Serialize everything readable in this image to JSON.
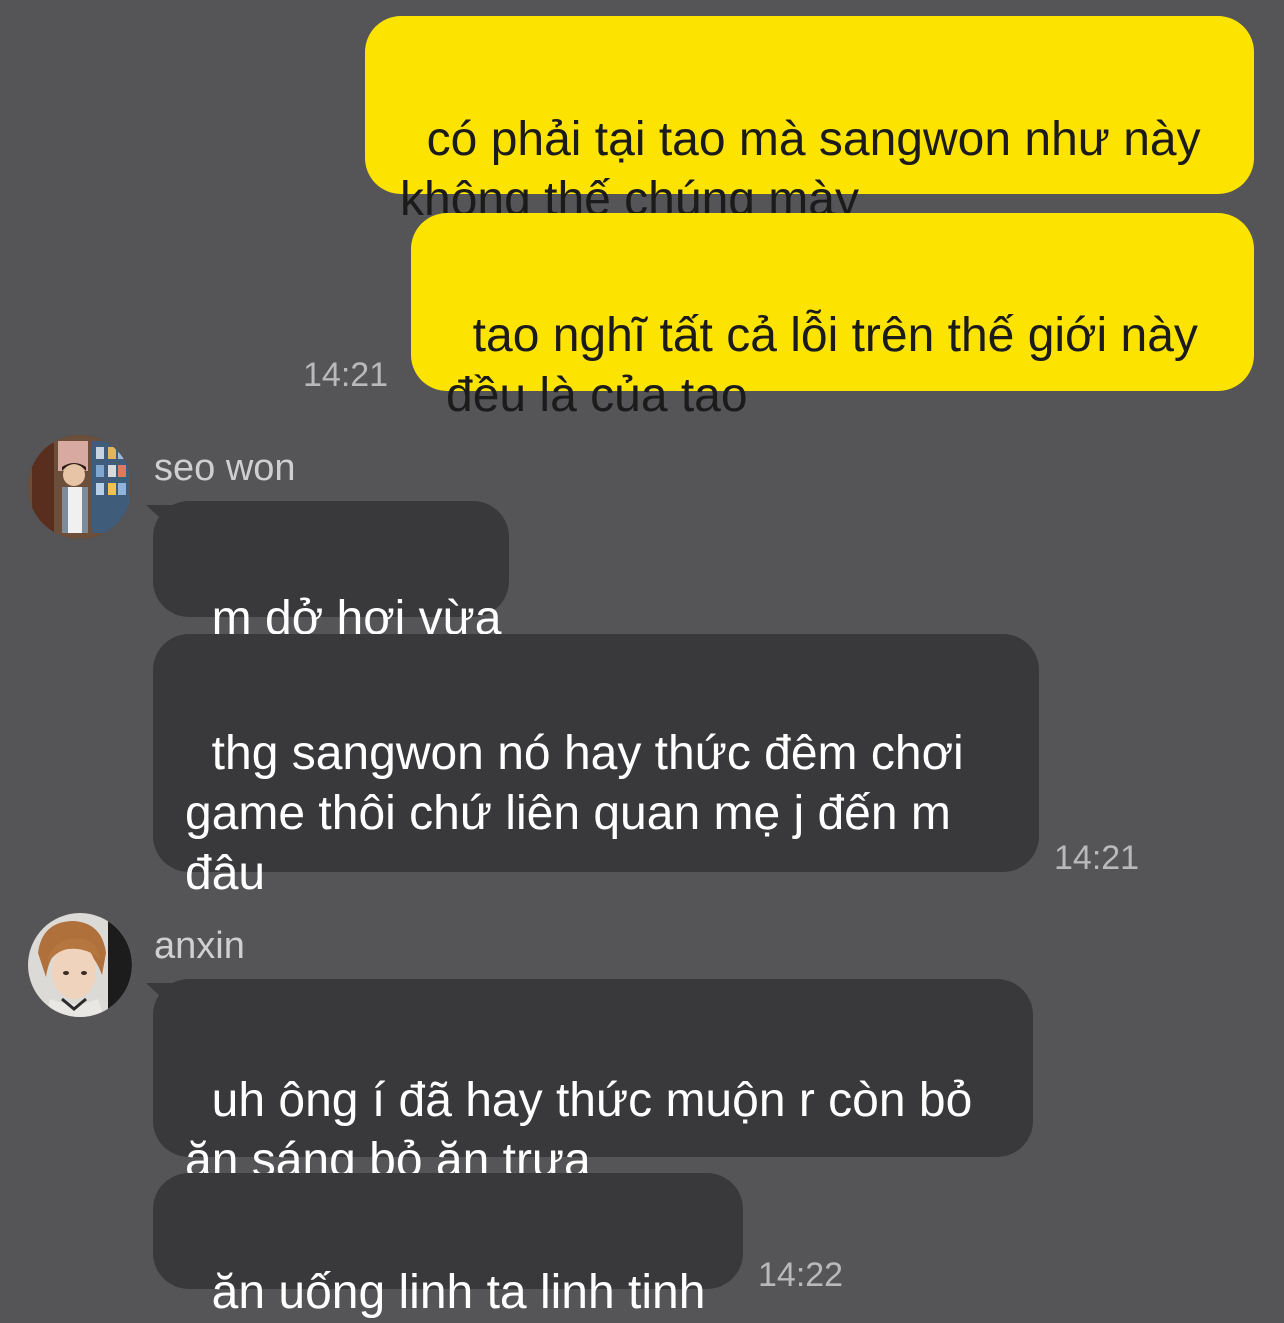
{
  "messages": [
    {
      "text": "có phải tại tao mà sangwon như này\nkhông thế chúng mày"
    },
    {
      "text": "tao nghĩ tất cả lỗi trên thế giới này\nđều là của tao",
      "time": "14:21"
    },
    {
      "sender": "seo won",
      "text": "m dở hơi vừa"
    },
    {
      "text": "thg sangwon nó hay thức đêm chơi\ngame thôi chứ liên quan mẹ j đến m\nđâu",
      "time": "14:21"
    },
    {
      "sender": "anxin",
      "text": "uh ông í đã hay thức muộn r còn bỏ\năn sáng bỏ ăn trưa"
    },
    {
      "text": "ăn uống linh ta linh tinh",
      "time": "14:22"
    }
  ],
  "colors": {
    "background": "#555456",
    "outgoing_bubble": "#fde300",
    "incoming_bubble": "#39393b"
  }
}
